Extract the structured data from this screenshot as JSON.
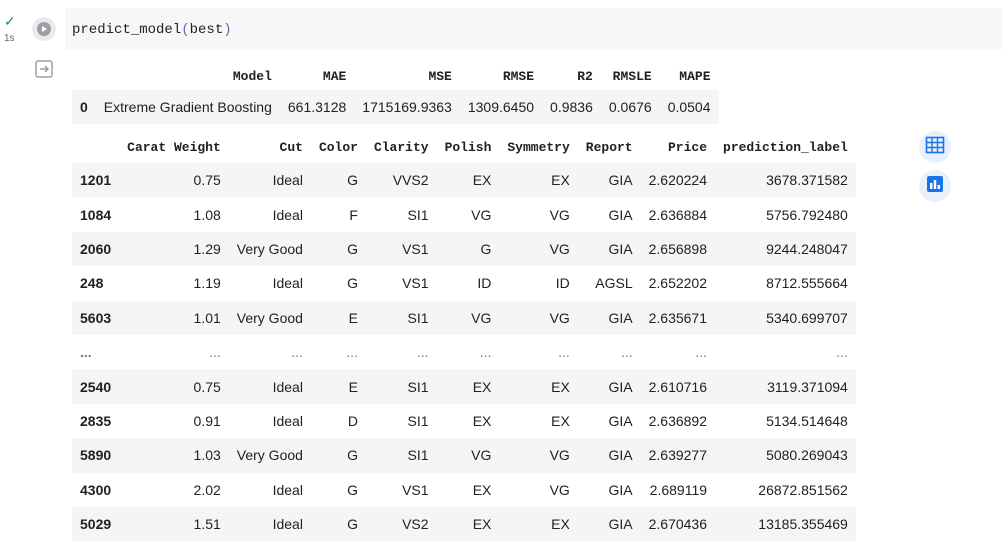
{
  "cell": {
    "exec_status": "✓",
    "exec_time": "1s",
    "code": {
      "fn": "predict_model",
      "open": "(",
      "arg": "best",
      "close": ")"
    }
  },
  "metrics_table": {
    "columns": [
      "",
      "Model",
      "MAE",
      "MSE",
      "RMSE",
      "R2",
      "RMSLE",
      "MAPE"
    ],
    "row": [
      "0",
      "Extreme Gradient Boosting",
      "661.3128",
      "1715169.9363",
      "1309.6450",
      "0.9836",
      "0.0676",
      "0.0504"
    ]
  },
  "prediction_table": {
    "columns": [
      "",
      "Carat Weight",
      "Cut",
      "Color",
      "Clarity",
      "Polish",
      "Symmetry",
      "Report",
      "Price",
      "prediction_label"
    ],
    "rows": [
      [
        "1201",
        "0.75",
        "Ideal",
        "G",
        "VVS2",
        "EX",
        "EX",
        "GIA",
        "2.620224",
        "3678.371582"
      ],
      [
        "1084",
        "1.08",
        "Ideal",
        "F",
        "SI1",
        "VG",
        "VG",
        "GIA",
        "2.636884",
        "5756.792480"
      ],
      [
        "2060",
        "1.29",
        "Very Good",
        "G",
        "VS1",
        "G",
        "VG",
        "GIA",
        "2.656898",
        "9244.248047"
      ],
      [
        "248",
        "1.19",
        "Ideal",
        "G",
        "VS1",
        "ID",
        "ID",
        "AGSL",
        "2.652202",
        "8712.555664"
      ],
      [
        "5603",
        "1.01",
        "Very Good",
        "E",
        "SI1",
        "VG",
        "VG",
        "GIA",
        "2.635671",
        "5340.699707"
      ],
      [
        "...",
        "...",
        "...",
        "...",
        "...",
        "...",
        "...",
        "...",
        "...",
        "..."
      ],
      [
        "2540",
        "0.75",
        "Ideal",
        "E",
        "SI1",
        "EX",
        "EX",
        "GIA",
        "2.610716",
        "3119.371094"
      ],
      [
        "2835",
        "0.91",
        "Ideal",
        "D",
        "SI1",
        "EX",
        "EX",
        "GIA",
        "2.636892",
        "5134.514648"
      ],
      [
        "5890",
        "1.03",
        "Very Good",
        "G",
        "SI1",
        "VG",
        "VG",
        "GIA",
        "2.639277",
        "5080.269043"
      ],
      [
        "4300",
        "2.02",
        "Ideal",
        "G",
        "VS1",
        "EX",
        "VG",
        "GIA",
        "2.689119",
        "26872.851562"
      ],
      [
        "5029",
        "1.51",
        "Ideal",
        "G",
        "VS2",
        "EX",
        "EX",
        "GIA",
        "2.670436",
        "13185.355469"
      ]
    ]
  },
  "side_buttons": [
    "table-icon",
    "chart-icon"
  ],
  "colors": {
    "accent": "#1a73e8",
    "check": "#1e8e3e",
    "stripe": "#f5f5f5",
    "code_bg": "#f7f7f7"
  }
}
